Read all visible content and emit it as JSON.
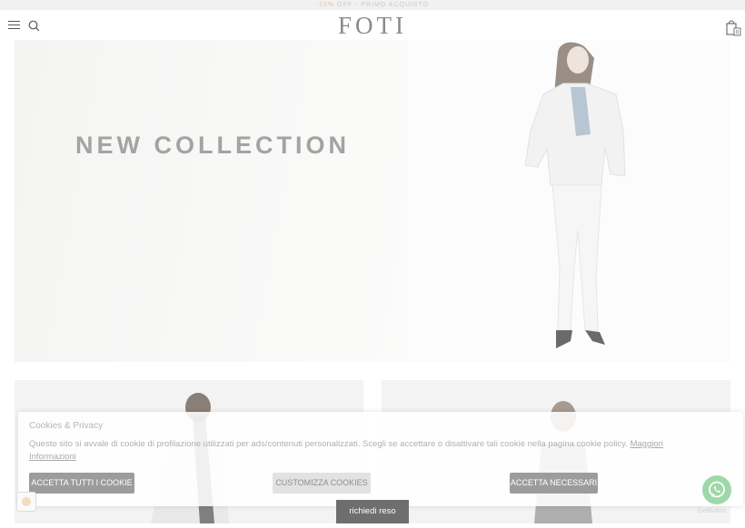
{
  "promo": {
    "accent": "-15%",
    "text": " OFF - PRIMO ACQUISTO"
  },
  "header": {
    "logo": "FOTI",
    "cart_count": "0"
  },
  "hero": {
    "title": "NEW COLLECTION"
  },
  "cookie": {
    "title": "Cookies & Privacy",
    "text": "Questo sito si avvale di cookie di profilazione utilizzati per ads/contenuti personalizzati. Scegli se accettare o disattivare tali cookie nella pagina cookie policy. ",
    "link": "Maggiori Informazioni",
    "accept_all": "ACCETTA TUTTI I COOKIE",
    "customize": "CUSTOMIZZA COOKIES",
    "accept_needed": "ACCETTA NECESSARI"
  },
  "return_button": "richiedi reso",
  "getbutton": "GetButton",
  "colors": {
    "accent": "#f4b8a6",
    "whatsapp": "#25d366",
    "button": "#9c9c9c"
  }
}
